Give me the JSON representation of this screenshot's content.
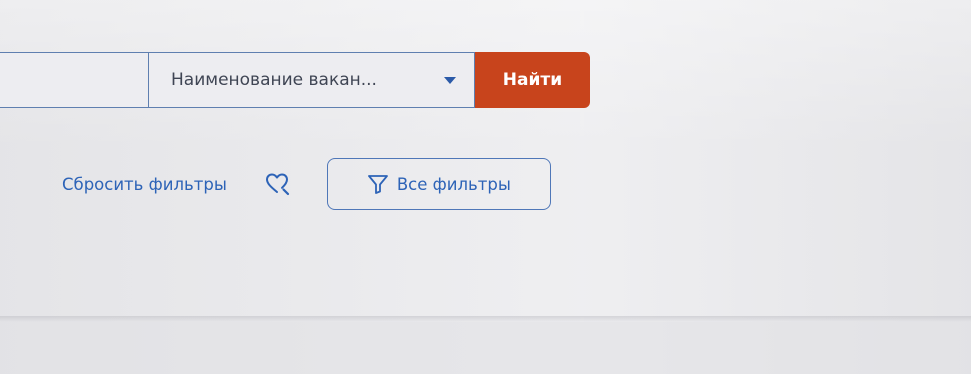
{
  "search": {
    "input_value": "",
    "select_value": "Наименование вакан...",
    "button_label": "Найти"
  },
  "filters": {
    "reset_label": "Сбросить фильтры",
    "all_filters_label": "Все фильтры",
    "favorite_search_icon": "heart-search-icon",
    "all_filters_icon": "filter-funnel-icon"
  },
  "colors": {
    "accent_blue": "#2d63b7",
    "button_orange": "#c8441c",
    "border_blue": "#5f7fb0",
    "background": "#e9e9ec"
  }
}
